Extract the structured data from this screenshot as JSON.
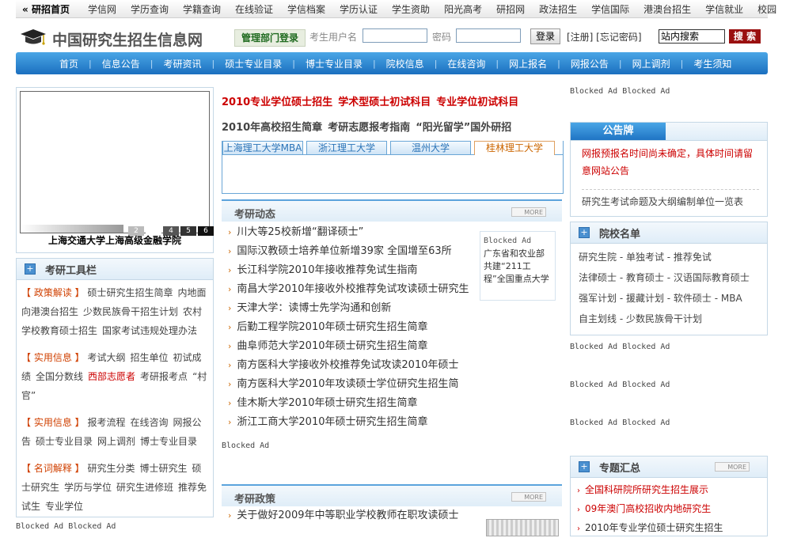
{
  "topbar": {
    "home_label": "研招首页",
    "links": [
      "学信网",
      "学历查询",
      "学籍查询",
      "在线验证",
      "学信档案",
      "学历认证",
      "学生资助",
      "阳光高考",
      "研招网",
      "政法招生",
      "学信国际",
      "港澳台招生",
      "学信就业",
      "校园"
    ]
  },
  "header": {
    "logo_text": "中国研究生招生信息网",
    "admin_login": "管理部门登录",
    "user_label": "考生用户名",
    "password_label": "密码",
    "login_button": "登录",
    "register_links": "[注册] [忘记密码]",
    "search_value": "站内搜索",
    "search_button": "搜 索"
  },
  "nav": [
    "首页",
    "信息公告",
    "考研资讯",
    "硕士专业目录",
    "博士专业目录",
    "院校信息",
    "在线咨询",
    "网上报名",
    "网报公告",
    "网上调剂",
    "考生须知"
  ],
  "left": {
    "ad_numbers": [
      "2",
      "",
      "4",
      "5",
      "6"
    ],
    "ad_caption": "上海交通大学上海高级金融学院",
    "tools_title": "考研工具栏",
    "groups": [
      {
        "tag": "【 政策解读 】",
        "items": [
          "硕士研究生招生简章",
          "内地面向港澳台招生",
          "少数民族骨干招生计划",
          "农村学校教育硕士招生",
          "国家考试违规处理办法"
        ]
      },
      {
        "tag": "【 实用信息 】",
        "items": [
          "考试大纲",
          "招生单位",
          "初试成绩",
          "全国分数线"
        ],
        "highlight": "西部志愿者",
        "items2": [
          "考研报考点",
          "“村官”"
        ]
      },
      {
        "tag": "【 实用信息 】",
        "items": [
          "报考流程",
          "在线咨询",
          "网报公告",
          "硕士专业目录",
          "网上调剂",
          "博士专业目录"
        ]
      },
      {
        "tag": "【 名词解释 】",
        "items": [
          "研究生分类",
          "博士研究生",
          "硕士研究生",
          "学历与学位",
          "研究生进修班",
          "推荐免试生",
          "专业学位"
        ]
      }
    ],
    "blocked": "Blocked Ad Blocked Ad"
  },
  "middle": {
    "headline1": [
      "2010专业学位硕士招生",
      "学术型硕士初试科目",
      "专业学位初试科目"
    ],
    "headline2": [
      "2010年高校招生简章",
      "考研志愿报考指南",
      "“阳光留学”国外研招"
    ],
    "tabs": [
      "上海理工大学MBA",
      "浙江理工大学",
      "温州大学",
      "桂林理工大学"
    ],
    "news_title": "考研动态",
    "more": "MORE",
    "news": [
      "川大等25校新增“翻译硕士”",
      "国际汉教硕士培养单位新增39家 全国增至63所",
      "长江科学院2010年接收推荐免试生指南",
      "南昌大学2010年接收外校推荐免试攻读硕士研究生",
      "天津大学：读博士先学沟通和创新",
      "后勤工程学院2010年硕士研究生招生简章",
      "曲阜师范大学2010年硕士研究生招生简章",
      "南方医科大学接收外校推荐免试攻读2010年硕士",
      "南方医科大学2010年攻读硕士学位研究生招生简",
      "佳木斯大学2010年硕士研究生招生简章",
      "浙江工商大学2010年硕士研究生招生简章"
    ],
    "side_blocked": "Blocked Ad",
    "side_text": "广东省和农业部共建“211工程”全国重点大学",
    "blocked": "Blocked Ad",
    "policy_title": "考研政策",
    "policy_items": [
      "关于做好2009年中等职业学校教师在职攻读硕士"
    ]
  },
  "right": {
    "top_blocked": "Blocked Ad Blocked Ad",
    "board_title": "公告牌",
    "board_red": "网报预报名时间尚未确定，具体时间请留意网站公告",
    "board_link": "研究生考试命题及大纲编制单位一览表",
    "schools_title": "院校名单",
    "schools_rows": [
      "研究生院 - 单独考试 - 推荐免试",
      "法律硕士 - 教育硕士 - 汉语国际教育硕士",
      "强军计划 - 援藏计划 - 软件硕士 - MBA",
      "自主划线 - 少数民族骨干计划"
    ],
    "blocked1": "Blocked Ad Blocked Ad",
    "blocked2": "Blocked Ad Blocked Ad",
    "blocked3": "Blocked Ad Blocked Ad",
    "topics_title": "专题汇总",
    "topics": [
      "全国科研院所研究生招生展示",
      "09年澳门高校招收内地研究生",
      "2010年专业学位硕士研究生招生"
    ]
  },
  "colors": {
    "nav_blue": "#1b6fbf",
    "accent_red": "#cc0000",
    "search_button": "#9a1010"
  }
}
